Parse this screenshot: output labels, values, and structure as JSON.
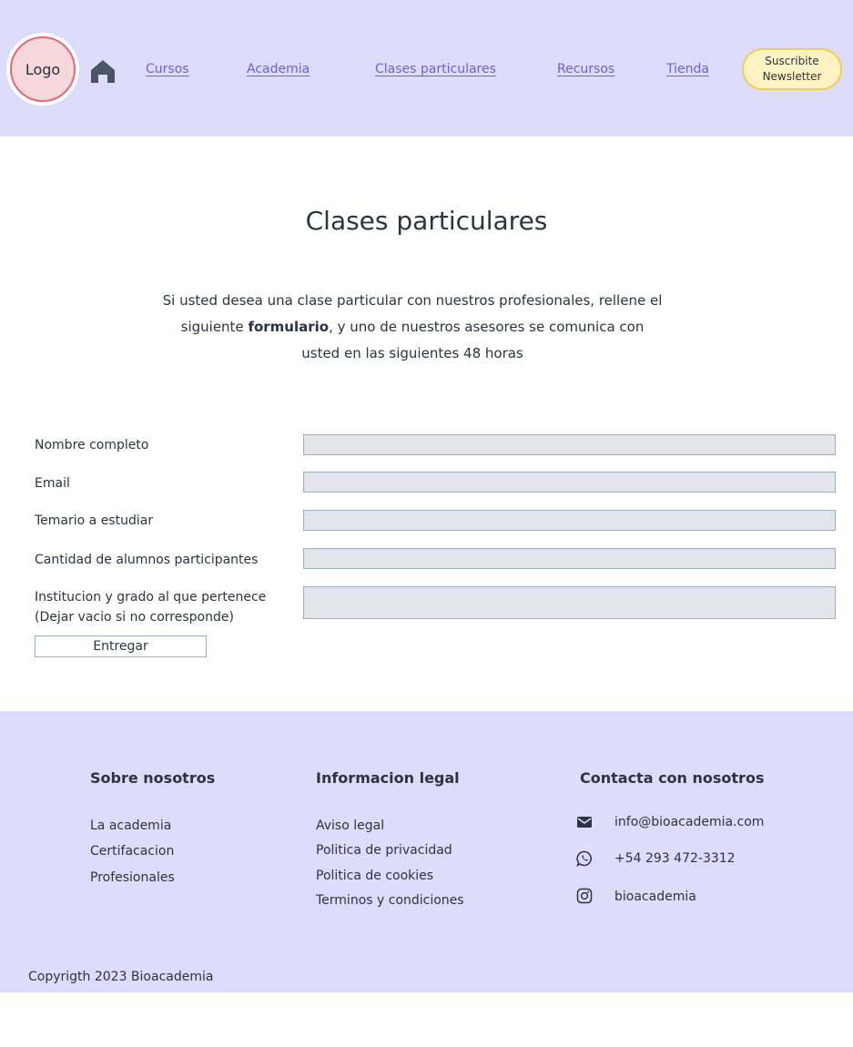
{
  "header": {
    "logo_text": "Logo",
    "home_icon": "home-icon",
    "nav": [
      "Cursos",
      "Academia",
      "Clases particulares",
      "Recursos",
      "Tienda"
    ],
    "newsletter_label": "Suscribite\nNewsletter"
  },
  "main": {
    "title": "Clases particulares",
    "intro_before": "Si usted desea una clase particular con nuestros profesionales, rellene el siguiente ",
    "intro_bold": "formulario",
    "intro_after": ", y uno de nuestros asesores se comunica con usted en las siguientes 48 horas"
  },
  "form": {
    "fields": [
      {
        "label": "Nombre completo",
        "value": ""
      },
      {
        "label": "Email",
        "value": ""
      },
      {
        "label": "Temario a estudiar",
        "value": ""
      },
      {
        "label": "Cantidad de alumnos participantes",
        "value": ""
      },
      {
        "label": "Institucion y grado al que pertenece",
        "label2": "(Dejar vacio si no corresponde)",
        "value": ""
      }
    ],
    "submit_label": "Entregar"
  },
  "footer": {
    "about": {
      "heading": "Sobre nosotros",
      "links": [
        "La academia",
        "Certifacacion",
        "Profesionales"
      ]
    },
    "legal": {
      "heading": "Informacion legal",
      "links": [
        "Aviso legal",
        "Politica de privacidad",
        "Politica de cookies",
        "Terminos y condiciones"
      ]
    },
    "contact": {
      "heading": "Contacta con nosotros",
      "items": [
        {
          "icon": "mail-icon",
          "text": "info@bioacademia.com"
        },
        {
          "icon": "whatsapp-icon",
          "text": "+54 293 472-3312"
        },
        {
          "icon": "instagram-icon",
          "text": "bioacademia"
        }
      ]
    },
    "copyright": "Copyrigth 2023 Bioacademia"
  },
  "colors": {
    "header_bg": "#dedcfb",
    "nav_link": "#6a60e0",
    "newsletter_bg": "#fff3c4",
    "newsletter_border": "#f1cd52",
    "input_bg": "#e2e6ec"
  }
}
